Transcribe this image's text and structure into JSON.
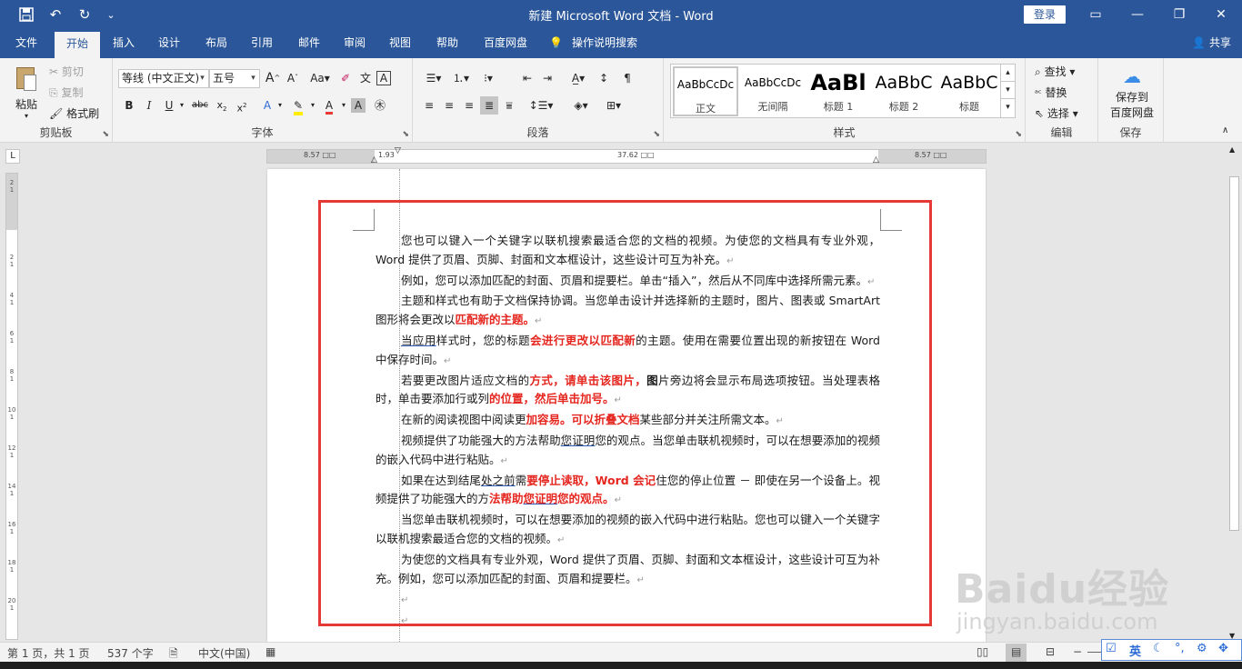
{
  "window": {
    "title": "新建 Microsoft Word 文档  -  Word",
    "login": "登录",
    "save_icon": "save-icon",
    "undo_icon": "undo-icon",
    "redo_icon": "redo-icon"
  },
  "tabs": [
    "文件",
    "开始",
    "插入",
    "设计",
    "布局",
    "引用",
    "邮件",
    "审阅",
    "视图",
    "帮助",
    "百度网盘"
  ],
  "tell_me": "操作说明搜索",
  "share": "共享",
  "ribbon": {
    "clipboard": {
      "paste": "粘贴",
      "cut": "剪切",
      "copy": "复制",
      "format_painter": "格式刷",
      "label": "剪贴板"
    },
    "font": {
      "font_name": "等线 (中文正文)",
      "font_size": "五号",
      "label": "字体"
    },
    "paragraph": {
      "label": "段落"
    },
    "styles": {
      "label": "样式",
      "items": [
        {
          "preview": "AaBbCcDc",
          "name": "正文"
        },
        {
          "preview": "AaBbCcDc",
          "name": "无间隔"
        },
        {
          "preview": "AaBl",
          "name": "标题 1"
        },
        {
          "preview": "AaBbC",
          "name": "标题 2"
        },
        {
          "preview": "AaBbC",
          "name": "标题"
        }
      ]
    },
    "editing": {
      "find": "查找",
      "replace": "替换",
      "select": "选择",
      "label": "编辑"
    },
    "save": {
      "button": "保存到\n百度网盘",
      "line1": "保存到",
      "line2": "百度网盘",
      "label": "保存"
    }
  },
  "ruler": {
    "left_margin": "8.57 □□",
    "indent": "1.93",
    "text_width": "37.62 □□",
    "right_margin": "8.57 □□"
  },
  "document": {
    "paragraphs": [
      "您也可以键入一个关键字以联机搜索最适合您的文档的视频。为使您的文档具有专业外观，Word 提供了页眉、页脚、封面和文本框设计，这些设计可互为补充。",
      "例如，您可以添加匹配的封面、页眉和提要栏。单击“插入”，然后从不同库中选择所需元素。",
      "主题和样式也有助于文档保持协调。当您单击设计并选择新的主题时，图片、图表或 SmartArt 图形将会更改以",
      "匹配新的主题。",
      "当应用",
      "样式时，您的标题",
      "会进行更改以匹配新",
      "的主题。使用在需要位置出现的新按钮在 Word 中保存时间。",
      "若要更改图片适应文档的",
      "方式，请单击该图片，",
      "图",
      "片旁边将会显示布局选项按钮。当处理表格时，单击要添加行或列",
      "的位置，然后单击加号。",
      "在新的阅读视图中阅读更",
      "加容易。可以折叠文档",
      "某些部分并关注所需文本。",
      "视频提供了功能强大的方法帮助",
      "您证明",
      "您的观点。当您单击联机视频时，可以在想要添加的视频的嵌入代码中进行粘贴。",
      "如果在达到结尾",
      "处之前",
      "需",
      "要停止读取，Word 会记",
      "住您的停止位置 － 即使在另一个设备上。视频提供了功能强大的方",
      "法帮助",
      "您证明",
      "您的观点。",
      "当您单击联机视频时，可以在想要添加的视频的嵌入代码中进行粘贴。您也可以键入一个关键字以联机搜索最适合您的文档的视频。",
      "为使您的文档具有专业外观，Word 提供了页眉、页脚、封面和文本框设计，这些设计可互为补充。例如，您可以添加匹配的封面、页眉和提要栏。"
    ],
    "para_mark": "↵"
  },
  "statusbar": {
    "page": "第 1 页，共 1 页",
    "words": "537 个字",
    "language": "中文(中国)"
  },
  "ime": {
    "mode": "英"
  },
  "watermark": {
    "logo": "Baidu经验",
    "url": "jingyan.baidu.com"
  },
  "colors": {
    "title_bar": "#2b579a",
    "emphasis_red": "#e5261f",
    "frame_red": "#e53935"
  }
}
